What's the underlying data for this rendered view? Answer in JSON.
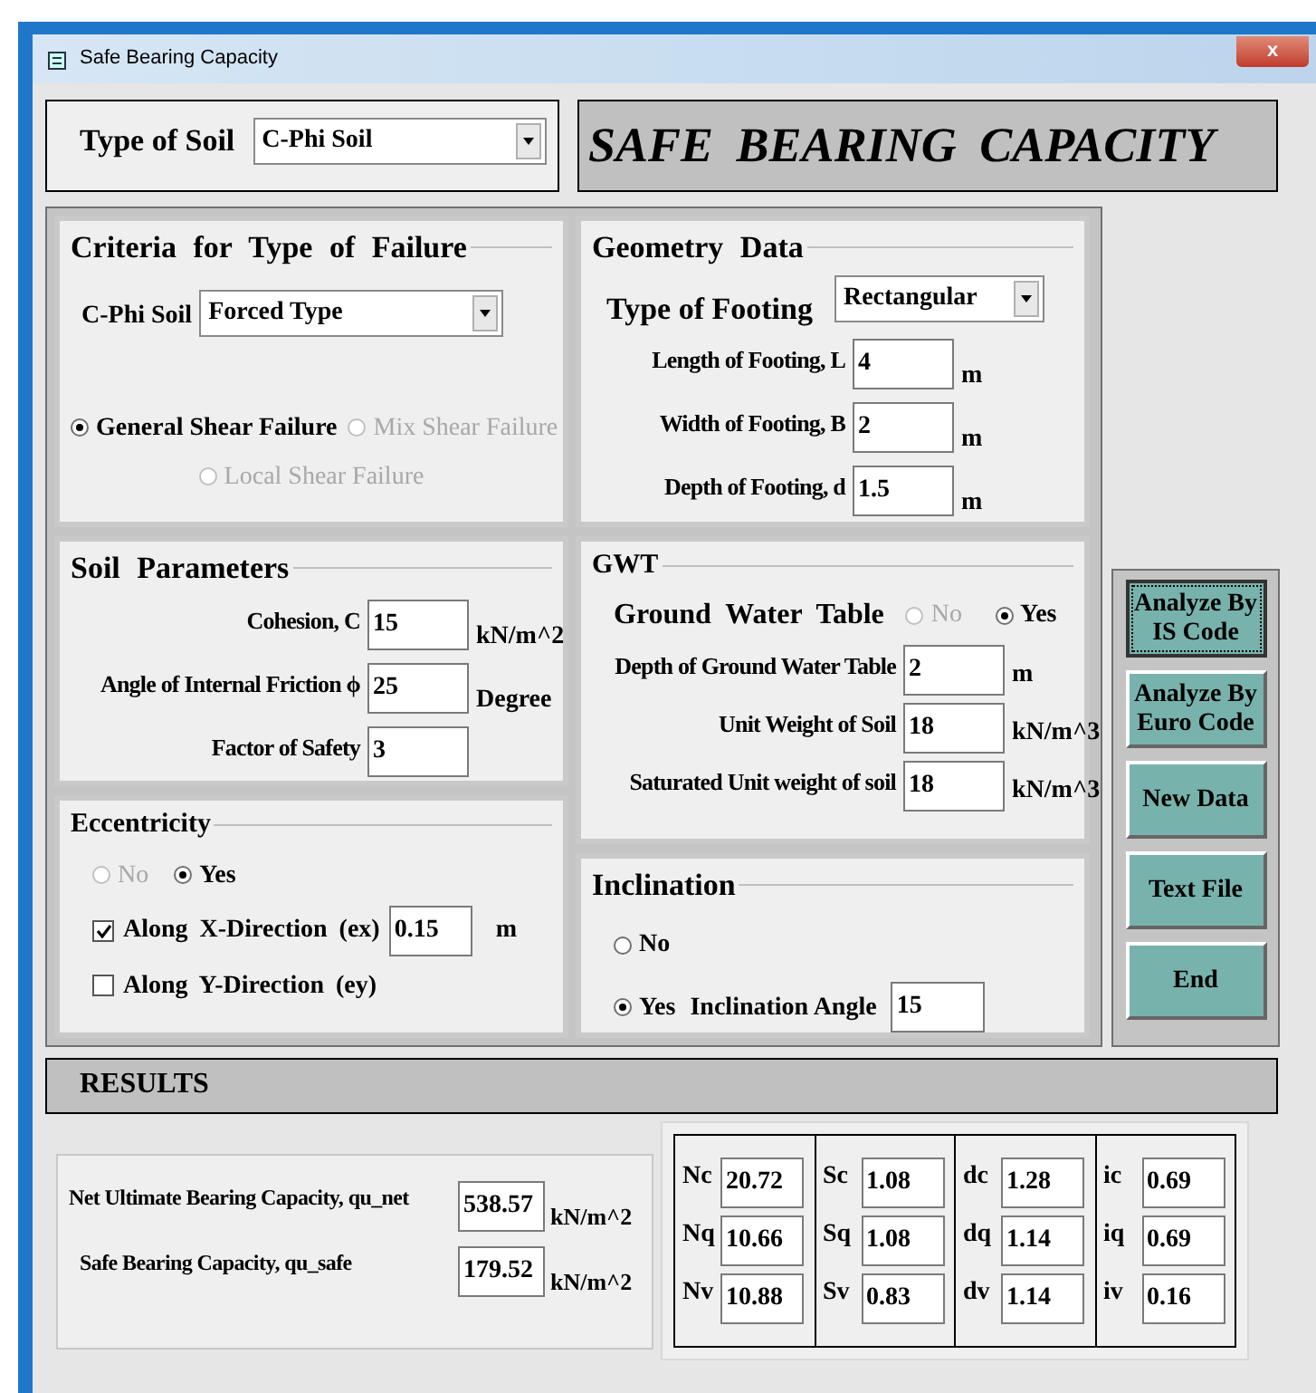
{
  "window": {
    "title": "Safe Bearing Capacity",
    "close": "x"
  },
  "soil_type": {
    "label": "Type of Soil",
    "value": "C-Phi Soil"
  },
  "heading": "SAFE BEARING CAPACITY",
  "criteria": {
    "title": "Criteria for Type of Failure",
    "soil_label": "C-Phi Soil",
    "value": "Forced Type",
    "options": [
      {
        "label": "General Shear Failure",
        "selected": true,
        "disabled": false
      },
      {
        "label": "Mix Shear Failure",
        "selected": false,
        "disabled": true
      },
      {
        "label": "Local Shear Failure",
        "selected": false,
        "disabled": true
      }
    ]
  },
  "soil_parameters": {
    "title": "Soil Parameters",
    "fields": [
      {
        "label": "Cohesion, C",
        "value": "15",
        "unit": "kN/m^2"
      },
      {
        "label": "Angle of Internal Friction ϕ",
        "value": "25",
        "unit": "Degree"
      },
      {
        "label": "Factor of Safety",
        "value": "3"
      }
    ]
  },
  "eccentricity": {
    "title": "Eccentricity",
    "options": [
      {
        "label": "No",
        "selected": false,
        "disabled": true
      },
      {
        "label": "Yes",
        "selected": true,
        "disabled": false
      }
    ],
    "directions": [
      {
        "label": "Along X-Direction (ex)",
        "checked": true,
        "value": "0.15",
        "unit": "m"
      },
      {
        "label": "Along Y-Direction (ey)",
        "checked": false
      }
    ]
  },
  "geometry": {
    "title": "Geometry Data",
    "footing_label": "Type of Footing",
    "footing_value": "Rectangular",
    "fields": [
      {
        "label": "Length of Footing, L",
        "value": "4",
        "unit": "m"
      },
      {
        "label": "Width of Footing, B",
        "value": "2",
        "unit": "m"
      },
      {
        "label": "Depth of Footing, d",
        "value": "1.5",
        "unit": "m"
      }
    ]
  },
  "gwt": {
    "title": "GWT",
    "table_label": "Ground Water Table",
    "options": [
      {
        "label": "No",
        "selected": false,
        "disabled": true
      },
      {
        "label": "Yes",
        "selected": true,
        "disabled": false
      }
    ],
    "fields": [
      {
        "label": "Depth of Ground Water Table",
        "value": "2",
        "unit": "m"
      },
      {
        "label": "Unit Weight of Soil",
        "value": "18",
        "unit": "kN/m^3"
      },
      {
        "label": "Saturated Unit weight of soil",
        "value": "18",
        "unit": "kN/m^3"
      }
    ]
  },
  "inclination": {
    "title": "Inclination",
    "options": [
      {
        "label": "No",
        "selected": false,
        "disabled": false
      },
      {
        "label": "Yes",
        "selected": true,
        "disabled": false
      }
    ],
    "angle_label": "Inclination Angle",
    "angle_value": "15"
  },
  "buttons": [
    {
      "label": "Analyze By IS Code",
      "focused": true
    },
    {
      "label": "Analyze By Euro Code",
      "focused": false
    },
    {
      "label": "New Data",
      "focused": false
    },
    {
      "label": "Text File",
      "focused": false
    },
    {
      "label": "End",
      "focused": false
    }
  ],
  "results": {
    "title": "RESULTS",
    "fields": [
      {
        "label": "Net Ultimate Bearing Capacity, qu_net",
        "value": "538.57",
        "unit": "kN/m^2"
      },
      {
        "label": "Safe Bearing Capacity, qu_safe",
        "value": "179.52",
        "unit": "kN/m^2"
      }
    ],
    "factor_columns": [
      {
        "items": [
          {
            "symbol": "Nc",
            "value": "20.72"
          },
          {
            "symbol": "Nq",
            "value": "10.66"
          },
          {
            "symbol": "Nv",
            "value": "10.88"
          }
        ]
      },
      {
        "items": [
          {
            "symbol": "Sc",
            "value": "1.08"
          },
          {
            "symbol": "Sq",
            "value": "1.08"
          },
          {
            "symbol": "Sv",
            "value": "0.83"
          }
        ]
      },
      {
        "items": [
          {
            "symbol": "dc",
            "value": "1.28"
          },
          {
            "symbol": "dq",
            "value": "1.14"
          },
          {
            "symbol": "dv",
            "value": "1.14"
          }
        ]
      },
      {
        "items": [
          {
            "symbol": "ic",
            "value": "0.69"
          },
          {
            "symbol": "iq",
            "value": "0.69"
          },
          {
            "symbol": "iv",
            "value": "0.16"
          }
        ]
      }
    ]
  }
}
